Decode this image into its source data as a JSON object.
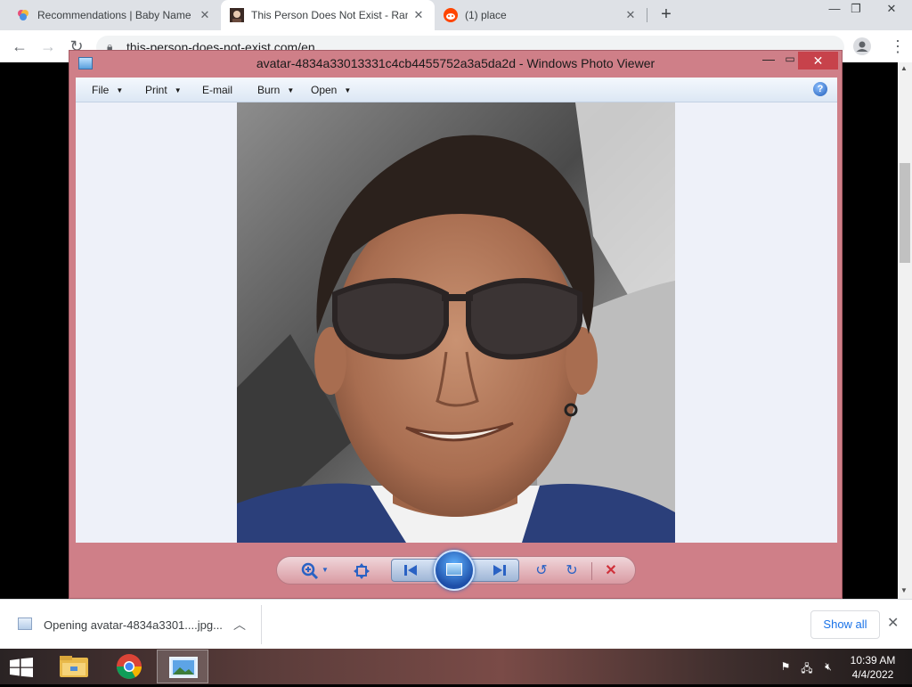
{
  "browser": {
    "tabs": [
      {
        "title": "Recommendations | Baby Name",
        "active": false
      },
      {
        "title": "This Person Does Not Exist - Ran",
        "active": true
      },
      {
        "title": "(1) place",
        "active": false
      }
    ],
    "new_tab_label": "+",
    "url": "this-person-does-not-exist.com/en"
  },
  "photo_viewer": {
    "title": "avatar-4834a33013331c4cb4455752a3a5da2d - Windows Photo Viewer",
    "menu": [
      {
        "label": "File",
        "dropdown": true
      },
      {
        "label": "Print",
        "dropdown": true
      },
      {
        "label": "E-mail",
        "dropdown": false
      },
      {
        "label": "Burn",
        "dropdown": true
      },
      {
        "label": "Open",
        "dropdown": true
      }
    ],
    "help_glyph": "?"
  },
  "download_bar": {
    "item_text": "Opening avatar-4834a3301....jpg...",
    "show_all_label": "Show all"
  },
  "taskbar": {
    "time": "10:39 AM",
    "date": "4/4/2022"
  },
  "colors": {
    "viewer_frame": "#cf7f88",
    "viewer_close": "#c7424b",
    "link_blue": "#1a73e8"
  }
}
